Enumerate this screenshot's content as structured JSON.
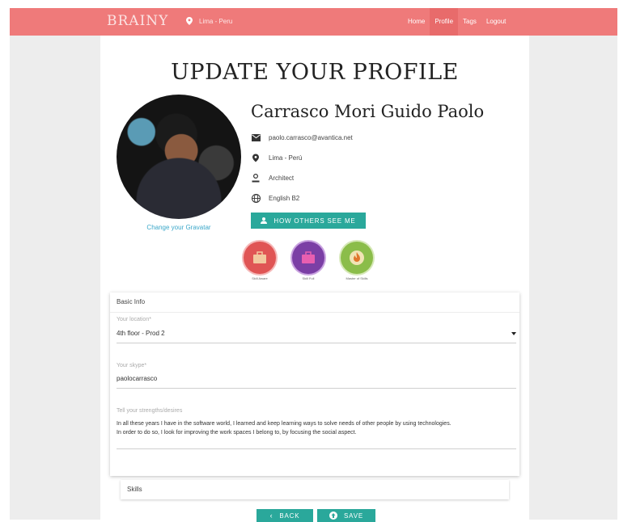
{
  "navbar": {
    "brand": "BRAINY",
    "location": "Lima - Peru",
    "items": [
      {
        "label": "Home"
      },
      {
        "label": "Profile"
      },
      {
        "label": "Tags"
      },
      {
        "label": "Logout"
      }
    ]
  },
  "page": {
    "title": "UPDATE YOUR PROFILE"
  },
  "profile": {
    "name": "Carrasco Mori Guido Paolo",
    "email": "paolo.carrasco@avantica.net",
    "location": "Lima - Perú",
    "role": "Architect",
    "language": "English B2",
    "change_gravatar": "Change your Gravatar",
    "how_others_label": "HOW OTHERS SEE ME"
  },
  "badges": [
    {
      "label": "Skill Aware",
      "color": "#e05555",
      "icon": "briefcase-icon"
    },
    {
      "label": "Skill Full",
      "color": "#7b3fa5",
      "icon": "briefcase-icon"
    },
    {
      "label": "Master of Skills",
      "color": "#8bbd4a",
      "icon": "flame-icon"
    }
  ],
  "basic_info": {
    "header": "Basic Info",
    "location_label": "Your location*",
    "location_value": "4th floor - Prod 2",
    "skype_label": "Your skype*",
    "skype_value": "paolocarrasco",
    "strengths_label": "Tell your strengths/desires",
    "strengths_line1": "In all these years I have in the software world, I learned and keep learning ways to solve needs of other people by using technologies.",
    "strengths_line2": "In order to do so, I look for improving the work spaces I belong to, by focusing the social aspect."
  },
  "skills": {
    "header": "Skills"
  },
  "actions": {
    "back_label": "BACK",
    "save_label": "SAVE"
  },
  "colors": {
    "navbar": "#ef7a7a",
    "accent": "#2aa89b",
    "link": "#3aa7c9"
  }
}
